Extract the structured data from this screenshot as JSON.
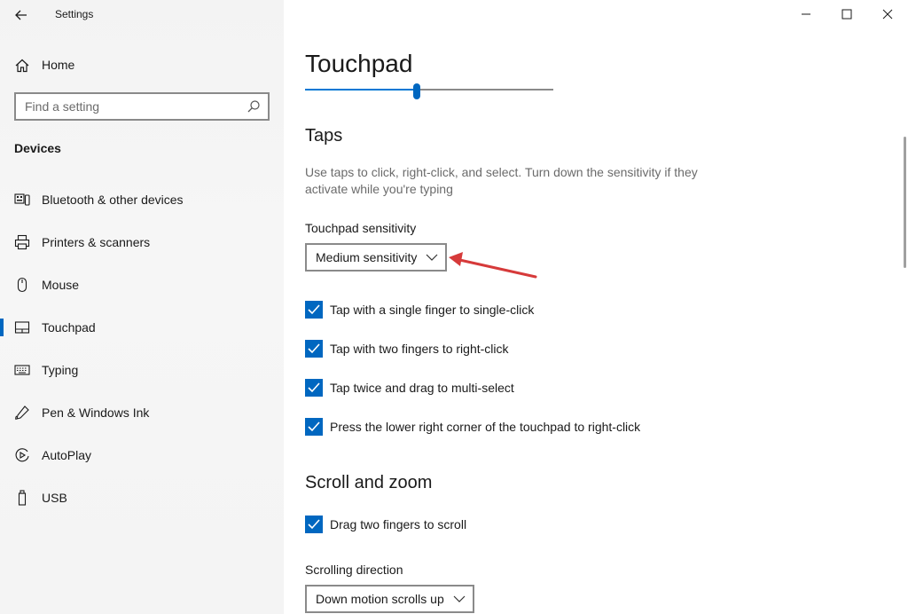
{
  "window": {
    "title": "Settings",
    "controls": [
      "minimize",
      "maximize",
      "close"
    ]
  },
  "sidebar": {
    "home_label": "Home",
    "search_placeholder": "Find a setting",
    "section_title": "Devices",
    "items": [
      {
        "label": "Bluetooth & other devices",
        "icon": "bluetooth-devices-icon",
        "active": false
      },
      {
        "label": "Printers & scanners",
        "icon": "printer-icon",
        "active": false
      },
      {
        "label": "Mouse",
        "icon": "mouse-icon",
        "active": false
      },
      {
        "label": "Touchpad",
        "icon": "touchpad-icon",
        "active": true
      },
      {
        "label": "Typing",
        "icon": "keyboard-icon",
        "active": false
      },
      {
        "label": "Pen & Windows Ink",
        "icon": "pen-icon",
        "active": false
      },
      {
        "label": "AutoPlay",
        "icon": "autoplay-icon",
        "active": false
      },
      {
        "label": "USB",
        "icon": "usb-icon",
        "active": false
      }
    ]
  },
  "main": {
    "title": "Touchpad",
    "cursor_speed_slider": {
      "value_fraction": 0.45
    },
    "taps": {
      "heading": "Taps",
      "description": "Use taps to click, right-click, and select. Turn down the sensitivity if they activate while you're typing",
      "sensitivity_label": "Touchpad sensitivity",
      "sensitivity_value": "Medium sensitivity",
      "checkboxes": [
        {
          "label": "Tap with a single finger to single-click",
          "checked": true
        },
        {
          "label": "Tap with two fingers to right-click",
          "checked": true
        },
        {
          "label": "Tap twice and drag to multi-select",
          "checked": true
        },
        {
          "label": "Press the lower right corner of the touchpad to right-click",
          "checked": true
        }
      ]
    },
    "scroll_zoom": {
      "heading": "Scroll and zoom",
      "checkboxes": [
        {
          "label": "Drag two fingers to scroll",
          "checked": true
        }
      ],
      "direction_label": "Scrolling direction",
      "direction_value": "Down motion scrolls up"
    }
  },
  "colors": {
    "accent": "#0067c0",
    "annotation_arrow": "#d63a3a",
    "sidebar_bg": "#f3f3f3"
  }
}
